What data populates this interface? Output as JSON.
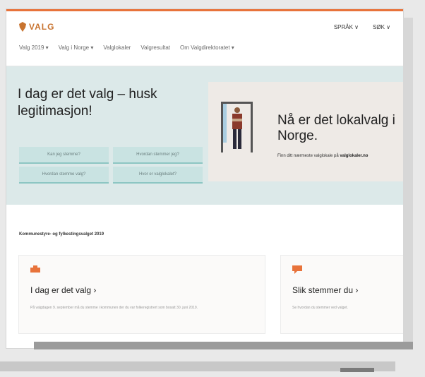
{
  "header": {
    "logo_text": "VALG",
    "top_links": [
      "SPRÅK ∨",
      "SØK ∨"
    ]
  },
  "nav": {
    "items": [
      "Valg 2019 ▾",
      "Valg i Norge ▾",
      "Valglokaler",
      "Valgresultat",
      "Om Valgdirektoratet ▾"
    ]
  },
  "hero": {
    "title": "I dag er det valg – husk legitimasjon!",
    "buttons": [
      "Kan jeg stemme?",
      "Hvordan stemmer jeg?",
      "Hvordan stemme valg?",
      "Hvor er valglokalet?"
    ]
  },
  "promo": {
    "title": "Nå er det lokalvalg i Norge.",
    "text": "Finn ditt nærmeste valglokale på",
    "link": "valglokaler.no"
  },
  "section": {
    "title": "Kommunestyre- og fylkestingsvalget 2019"
  },
  "cards": [
    {
      "title": "I dag er det valg ›",
      "text": "På valgdagen 9. september må du stemme i kommunen der du var folkeregistrert som bosatt 30. juni 2019.",
      "icon": "ballot-box-icon"
    },
    {
      "title": "Slik stemmer du ›",
      "text": "Se hvordan du stemmer ved valget.",
      "icon": "speech-bubble-icon"
    }
  ],
  "colors": {
    "accent": "#e8733b",
    "hero_bg": "#dce9e9",
    "button_bg": "#c9e3e2",
    "promo_bg": "#eeeae6"
  }
}
